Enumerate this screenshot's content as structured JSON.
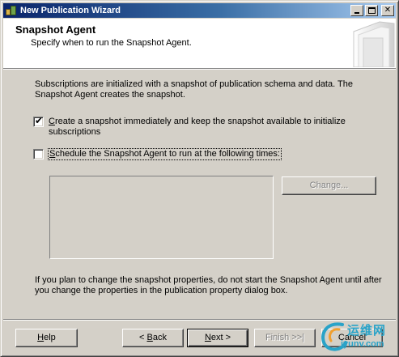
{
  "window": {
    "title": "New Publication Wizard"
  },
  "titlebar_buttons": {
    "minimize_icon": "minimize-icon",
    "maximize_icon": "maximize-icon",
    "close_glyph": "✕"
  },
  "header": {
    "title": "Snapshot Agent",
    "subtitle": "Specify when to run the Snapshot Agent."
  },
  "body": {
    "intro": "Subscriptions are initialized with a snapshot of publication schema and data. The Snapshot Agent creates the snapshot.",
    "create_snapshot": {
      "label": "Create a snapshot immediately and keep the snapshot available to initialize subscriptions",
      "checked": true,
      "check_glyph": "✔"
    },
    "schedule": {
      "label": "Schedule the Snapshot Agent to run at the following times:",
      "checked": false
    },
    "change_button": "Change...",
    "note": "If you plan to change the snapshot properties, do not start the Snapshot Agent until after you change the properties in the publication property dialog box."
  },
  "footer": {
    "help": "Help",
    "back": "< Back",
    "next": "Next >",
    "finish": "Finish >>|",
    "cancel": "Cancel"
  },
  "watermark": {
    "chinese": "运维网",
    "url": "iyunv.com"
  },
  "colors": {
    "titlebar_start": "#0a246a",
    "titlebar_end": "#a6caf0",
    "dialog_bg": "#d4d0c8",
    "watermark": "#2aa3c8"
  }
}
